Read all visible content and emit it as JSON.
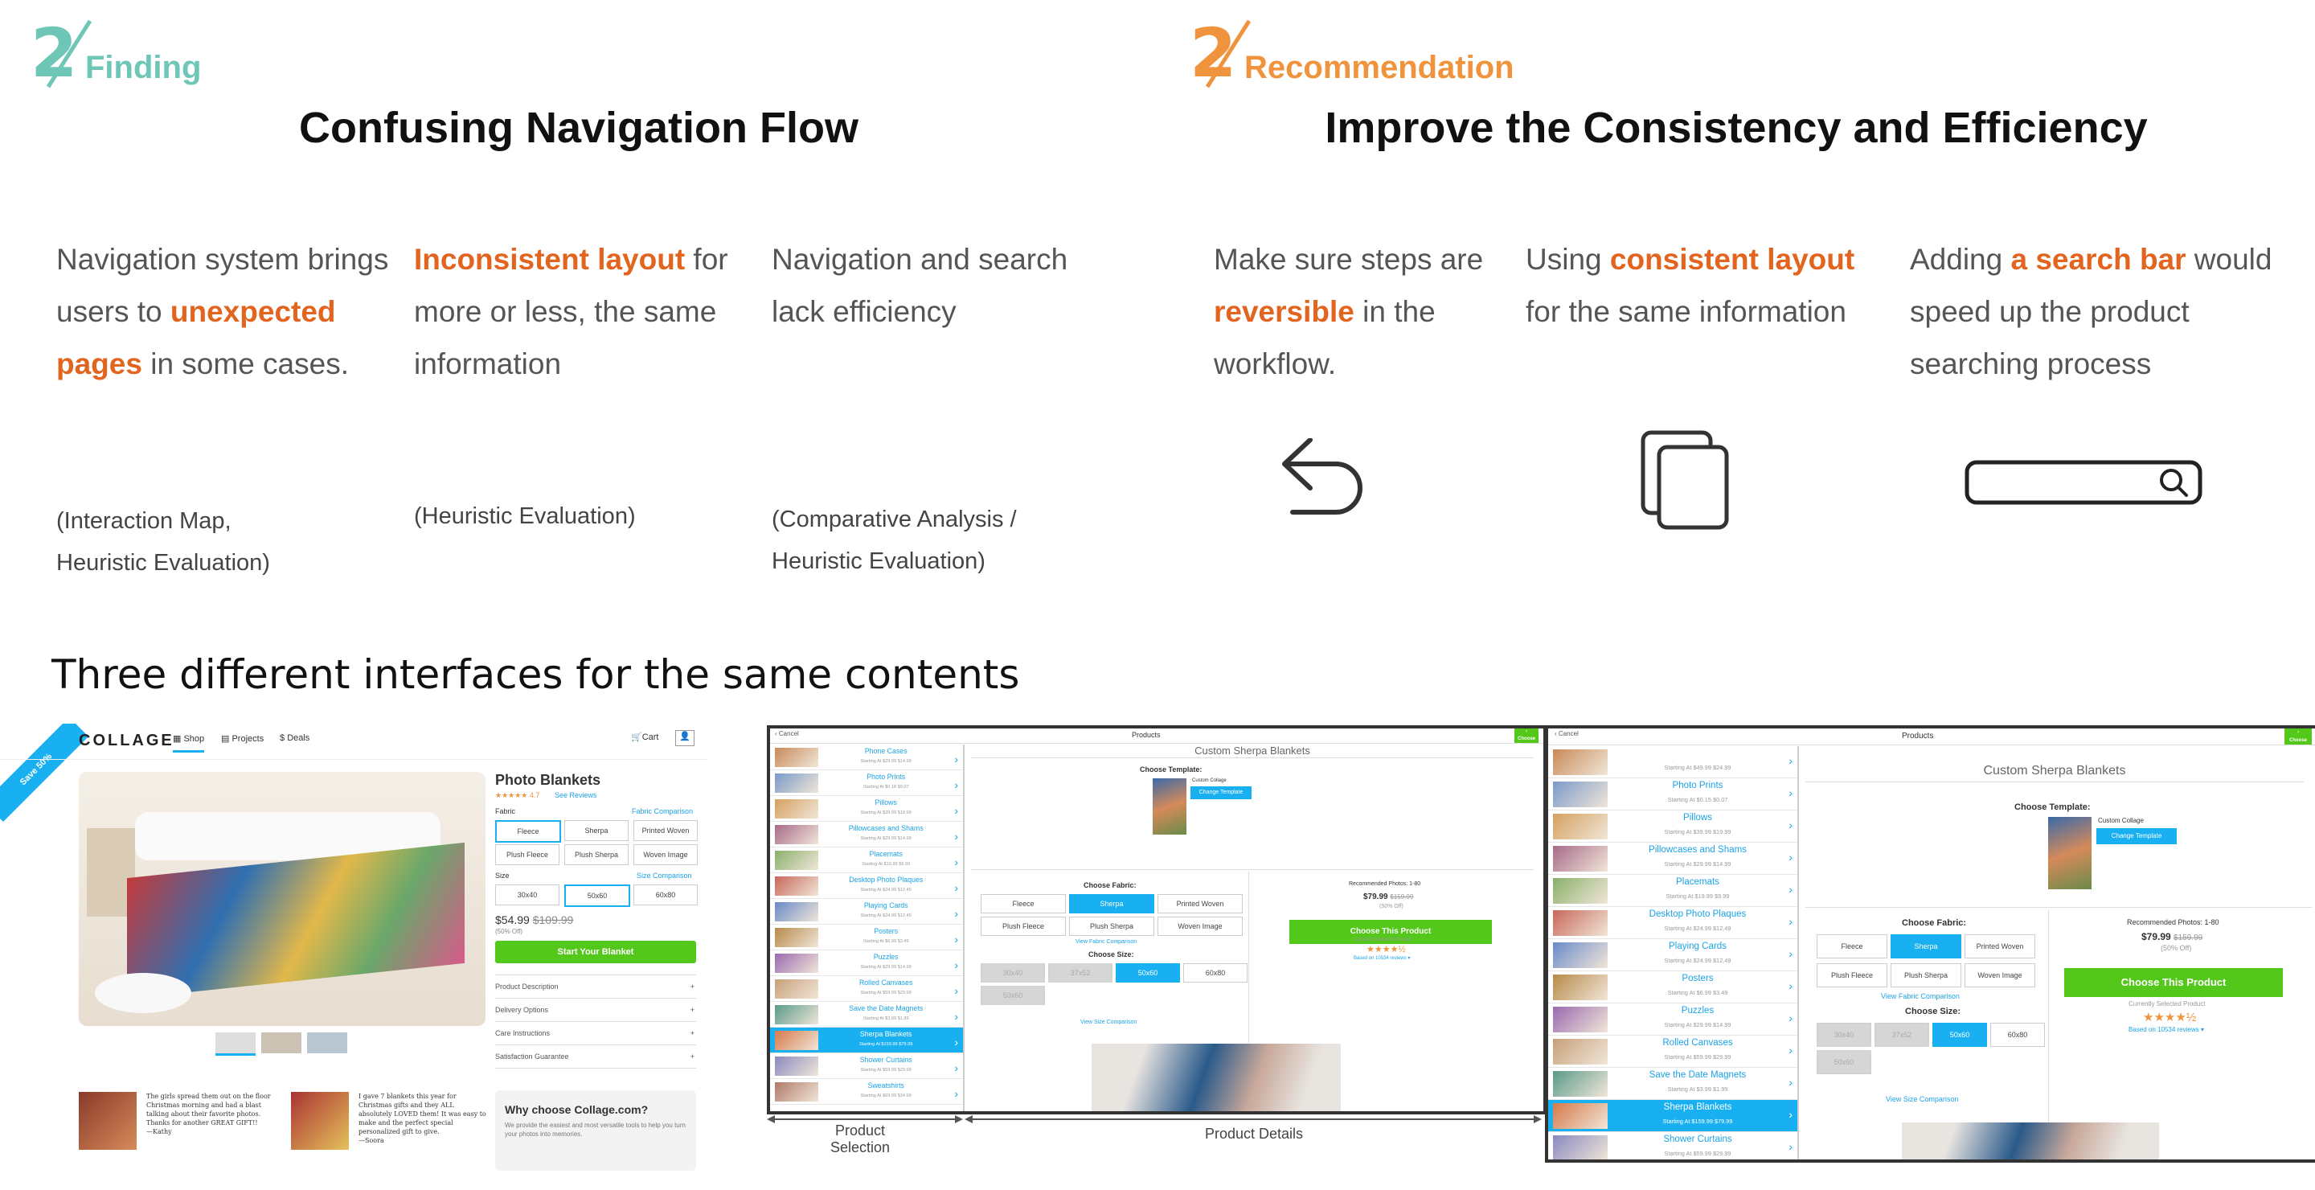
{
  "finding": {
    "badge_number": "2",
    "badge_label": "Finding",
    "title": "Confusing Navigation Flow",
    "col1": {
      "pre": "Navigation system brings users to ",
      "hl": "unexpected pages",
      "post": " in some cases.",
      "source": "(Interaction Map, Heuristic Evaluation)"
    },
    "col2": {
      "pre": "",
      "hl": "Inconsistent layout",
      "post": " for more or less,  the same information",
      "source": "(Heuristic Evaluation)"
    },
    "col3": {
      "pre": "Navigation and search lack efficiency",
      "source": "(Comparative Analysis / Heuristic Evaluation)"
    }
  },
  "recommendation": {
    "badge_number": "2",
    "badge_label": "Recommendation",
    "title": "Improve the Consistency and Efficiency",
    "col1": {
      "pre": "Make sure steps are ",
      "hl": "reversible",
      "post": " in the workflow.",
      "icon": "undo-arrow-icon"
    },
    "col2": {
      "pre": "Using ",
      "hl": "consistent layout",
      "post": " for the same information",
      "icon": "copy-pages-icon"
    },
    "col3": {
      "pre": "Adding ",
      "hl": "a search bar",
      "post": " would speed up the product searching  process",
      "icon": "search-bar-icon"
    }
  },
  "section_title": "Three different interfaces for the same contents",
  "captions": {
    "left": "Product Selection",
    "right": "Product Details"
  },
  "colors": {
    "teal": "#6ec6b6",
    "orange": "#f0933d",
    "highlight": "#e2641f",
    "accent_blue": "#19b0f2",
    "cta_green": "#53c71a"
  },
  "web_shot": {
    "logo": "COLLAGE",
    "nav": [
      "Shop",
      "Projects",
      "Deals"
    ],
    "cart": "Cart",
    "ribbon": "Save 50%",
    "product_title": "Photo Blankets",
    "rating": "★★★★★ 4.7",
    "see_reviews": "See Reviews",
    "fabric_label": "Fabric",
    "fabric_compare": "Fabric Comparison",
    "fabrics": [
      "Fleece",
      "Sherpa",
      "Printed Woven",
      "Plush Fleece",
      "Plush Sherpa",
      "Woven Image"
    ],
    "size_label": "Size",
    "size_compare": "Size Comparison",
    "sizes": [
      "30x40",
      "50x60",
      "60x80"
    ],
    "price": "$54.99",
    "old_price": "$109.99",
    "discount": "(50% Off)",
    "cta": "Start Your Blanket",
    "accordion": [
      "Product Description",
      "Delivery Options",
      "Care Instructions",
      "Satisfaction Guarantee"
    ],
    "review1": "The girls spread them out on the floor Christmas morning and had a blast talking about their favorite photos. Thanks for another GREAT GIFT!!",
    "review1_author": "—Kathy",
    "review2": "I gave 7 blankets this year for Christmas gifts and they ALL absolutely LOVED them! It was easy to make and the perfect special personalized gift to give.",
    "review2_author": "—Soora",
    "why_title": "Why choose Collage.com?",
    "why_text": "We provide the easiest and most versatile tools to help you turn your photos into memories."
  },
  "app_shot": {
    "back": "Cancel",
    "header": "Products",
    "next": "Choose Product",
    "product_title": "Custom Sherpa Blankets",
    "choose_template": "Choose Template:",
    "template_name": "Custom Collage",
    "change_template": "Change Template",
    "choose_fabric": "Choose Fabric:",
    "fabrics": [
      "Fleece",
      "Sherpa",
      "Printed Woven",
      "Plush Fleece",
      "Plush Sherpa",
      "Woven Image"
    ],
    "fabric_compare": "View Fabric Comparison",
    "choose_size": "Choose Size:",
    "sizes": [
      "30x40",
      "37x52",
      "50x60",
      "60x80",
      "50x60"
    ],
    "size_compare": "View Size Comparison",
    "recommended": "Recommended Photos: 1-80",
    "price": "$79.99",
    "old_price": "$159.99",
    "discount": "(50% Off)",
    "cta": "Choose This Product",
    "currently": "Currently Selected Product",
    "stars": "★★★★½",
    "reviews": "Based on 10534 reviews ▾",
    "products": [
      {
        "name": "Phone Cases",
        "price": "Starting At $29.99 $14.99"
      },
      {
        "name": "Photo Prints",
        "price": "Starting At $0.18 $0.07"
      },
      {
        "name": "Pillows",
        "price": "Starting At $39.99 $19.99"
      },
      {
        "name": "Pillowcases and Shams",
        "price": "Starting At $29.99 $14.99"
      },
      {
        "name": "Placemats",
        "price": "Starting At $19.99 $9.99"
      },
      {
        "name": "Desktop Photo Plaques",
        "price": "Starting At $24.99 $12.49"
      },
      {
        "name": "Playing Cards",
        "price": "Starting At $24.99 $12.49"
      },
      {
        "name": "Posters",
        "price": "Starting At $6.99 $3.49"
      },
      {
        "name": "Puzzles",
        "price": "Starting At $29.99 $14.99"
      },
      {
        "name": "Rolled Canvases",
        "price": "Starting At $59.99 $29.99"
      },
      {
        "name": "Save the Date Magnets",
        "price": "Starting At $3.99 $1.99"
      },
      {
        "name": "Sherpa Blankets",
        "price": "Starting At $159.99 $79.99"
      },
      {
        "name": "Shower Curtains",
        "price": "Starting At $59.99 $29.99"
      },
      {
        "name": "Sweatshirts",
        "price": "Starting At $69.99 $34.99"
      }
    ],
    "tablet_products": [
      {
        "name": "",
        "price": "Starting At $49.99 $24.99"
      },
      {
        "name": "Photo Prints",
        "price": "Starting At $0.15 $0.07"
      },
      {
        "name": "Pillows",
        "price": "Starting At $39.99 $19.99"
      },
      {
        "name": "Pillowcases and Shams",
        "price": "Starting At $29.99 $14.99"
      },
      {
        "name": "Placemats",
        "price": "Starting At $19.99 $9.99"
      },
      {
        "name": "Desktop Photo Plaques",
        "price": "Starting At $24.99 $12.49"
      },
      {
        "name": "Playing Cards",
        "price": "Starting At $24.99 $12.49"
      },
      {
        "name": "Posters",
        "price": "Starting At $6.99 $3.49"
      },
      {
        "name": "Puzzles",
        "price": "Starting At $29.99 $14.99"
      },
      {
        "name": "Rolled Canvases",
        "price": "Starting At $59.99 $29.99"
      },
      {
        "name": "Save the Date Magnets",
        "price": "Starting At $3.99 $1.99"
      },
      {
        "name": "Sherpa Blankets",
        "price": "Starting At $159.99 $79.99"
      },
      {
        "name": "Shower Curtains",
        "price": "Starting At $59.99 $29.99"
      }
    ]
  }
}
